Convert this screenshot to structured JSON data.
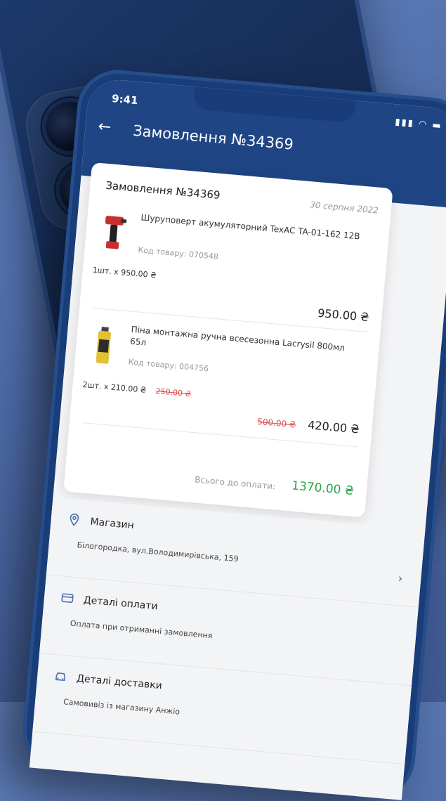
{
  "status_bar": {
    "time": "9:41"
  },
  "header": {
    "title": "Замовлення №34369"
  },
  "order": {
    "title": "Замовлення №34369",
    "date": "30 серпня 2022",
    "items": [
      {
        "name": "Шуруповерт акумуляторний TexAC TA-01-162 12В",
        "code": "Код товару: 070548",
        "qty_price": "1шт. x 950.00 ₴",
        "old_unit_price": "",
        "old_total": "",
        "total": "950.00 ₴"
      },
      {
        "name": "Піна монтажна ручна всесезонна Lacrysil 800мл 65л",
        "code": "Код товару: 004756",
        "qty_price": "2шт. x 210.00 ₴",
        "old_unit_price": "250.00 ₴",
        "old_total": "500.00 ₴",
        "total": "420.00 ₴"
      }
    ],
    "total_label": "Всього до оплати:",
    "total_value": "1370.00 ₴"
  },
  "store": {
    "title": "Магазин",
    "address": "Білогородка, вул.Володимирівська, 159"
  },
  "payment": {
    "title": "Деталі оплати",
    "method": "Оплата при отриманні замовлення"
  },
  "delivery": {
    "title": "Деталі доставки",
    "method": "Самовивіз із магазину Анжіо"
  },
  "icons": {
    "back": "arrow-left-icon",
    "store": "location-pin-icon",
    "payment": "credit-card-icon",
    "delivery": "car-icon",
    "chevron": "chevron-right-icon"
  },
  "colors": {
    "primary": "#1f4584",
    "total_green": "#28a745",
    "discount_red": "#d94b4b"
  }
}
